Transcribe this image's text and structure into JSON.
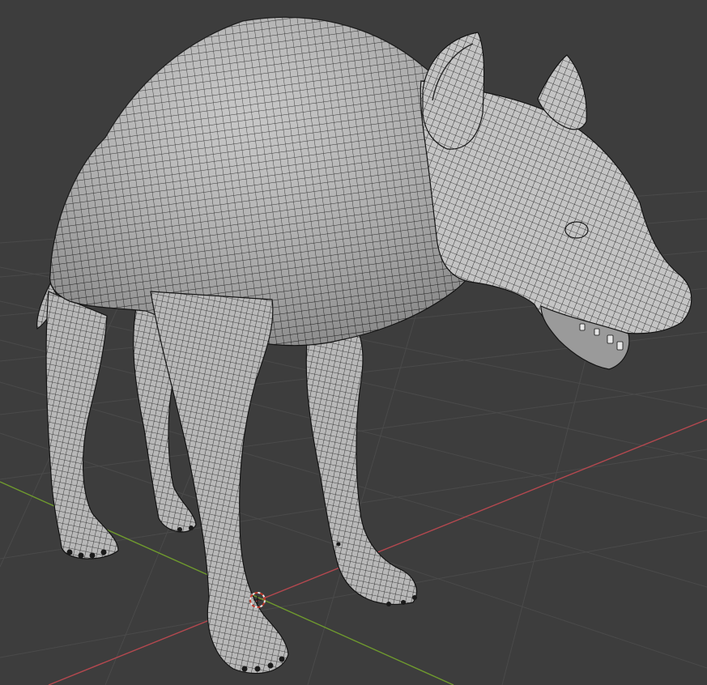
{
  "viewport": {
    "background_color": "#3d3d3d",
    "grid_line_color": "#4a4a4a",
    "x_axis_color": "#b4484f",
    "y_axis_color": "#6f9a2e",
    "mesh_fill_color": "#bdbdbd",
    "wire_color": "#1a1a1a"
  },
  "scene": {
    "object": "wireframe-mesh-quadruped",
    "cursor_icon": "3d-cursor-icon",
    "cursor_colors": [
      "#e8e8e8",
      "#c0392b"
    ]
  }
}
